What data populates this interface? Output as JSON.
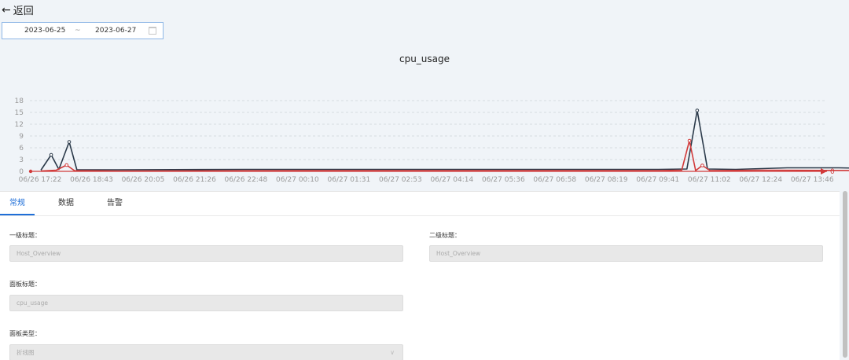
{
  "nav": {
    "back_label": "返回"
  },
  "date_range": {
    "start": "2023-06-25",
    "separator": "~",
    "end": "2023-06-27"
  },
  "chart_title": "cpu_usage",
  "tabs": [
    {
      "label": "常规",
      "active": true
    },
    {
      "label": "数据",
      "active": false
    },
    {
      "label": "告警",
      "active": false
    }
  ],
  "form": {
    "title1": {
      "label": "一级标题：",
      "value": "Host_Overview"
    },
    "title2": {
      "label": "二级标题：",
      "value": "Host_Overview"
    },
    "panel_title": {
      "label": "面板标题：",
      "value": "cpu_usage"
    },
    "panel_type": {
      "label": "面板类型：",
      "value": "折线图"
    }
  },
  "chart_data": {
    "type": "line",
    "title": "cpu_usage",
    "ylim": [
      0,
      18
    ],
    "yticks": [
      0,
      3,
      6,
      9,
      12,
      15,
      18
    ],
    "xticks": [
      "06/26 17:22",
      "06/26 18:43",
      "06/26 20:05",
      "06/26 21:26",
      "06/26 22:48",
      "06/27 00:10",
      "06/27 01:31",
      "06/27 02:53",
      "06/27 04:14",
      "06/27 05:36",
      "06/27 06:58",
      "06/27 08:19",
      "06/27 09:41",
      "06/27 11:02",
      "06/27 12:24",
      "06/27 13:46"
    ],
    "end_label": "0",
    "grid": true,
    "series": [
      {
        "color": "#2b3a4a",
        "points": [
          [
            0,
            0.3
          ],
          [
            0.2,
            4.2
          ],
          [
            0.35,
            0.5
          ],
          [
            0.55,
            7.5
          ],
          [
            0.7,
            0.4
          ],
          [
            1.5,
            0.4
          ],
          [
            4,
            0.5
          ],
          [
            8,
            0.5
          ],
          [
            12,
            0.5
          ],
          [
            12.55,
            0.6
          ],
          [
            12.75,
            15.5
          ],
          [
            12.95,
            0.6
          ],
          [
            13.5,
            0.5
          ],
          [
            14.5,
            0.9
          ],
          [
            15.5,
            0.9
          ],
          [
            15.9,
            0.8
          ]
        ]
      },
      {
        "color": "#d13a3a",
        "points": [
          [
            0,
            0.1
          ],
          [
            0.3,
            0.3
          ],
          [
            0.5,
            1.6
          ],
          [
            0.65,
            0.2
          ],
          [
            1.5,
            0.1
          ],
          [
            6,
            0.2
          ],
          [
            12,
            0.2
          ],
          [
            12.45,
            0.3
          ],
          [
            12.6,
            7.8
          ],
          [
            12.72,
            0.2
          ],
          [
            12.85,
            1.5
          ],
          [
            13,
            0.2
          ],
          [
            14,
            0.3
          ],
          [
            15.9,
            0.2
          ]
        ]
      }
    ]
  }
}
